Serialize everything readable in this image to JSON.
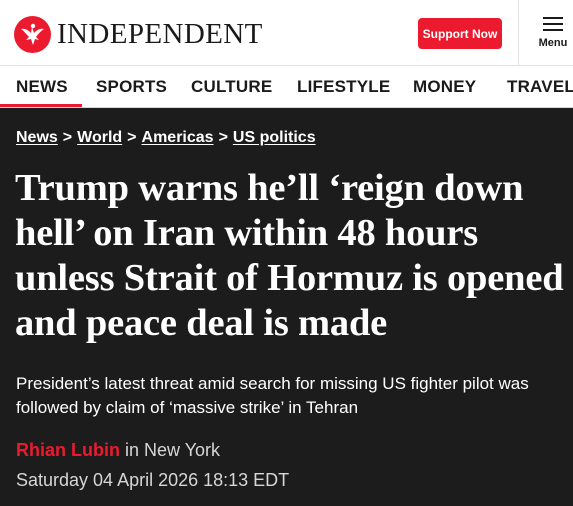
{
  "header": {
    "logo_text": "INDEPENDENT",
    "support_label": "Support Now",
    "menu_label": "Menu",
    "brand_color": "#ec1a2e"
  },
  "nav": {
    "items": [
      {
        "label": "NEWS",
        "active": true
      },
      {
        "label": "SPORTS"
      },
      {
        "label": "CULTURE"
      },
      {
        "label": "LIFESTYLE"
      },
      {
        "label": "MONEY"
      },
      {
        "label": "TRAVEL"
      }
    ]
  },
  "breadcrumb": {
    "items": [
      "News",
      "World",
      "Americas",
      "US politics"
    ],
    "separator": ">"
  },
  "article": {
    "headline": "Trump warns he’ll ‘reign down hell’ on Iran within 48 hours unless Strait of Hormuz is opened and peace deal is made",
    "standfirst": "President’s latest threat amid search for missing US fighter pilot was followed by claim of ‘massive strike’ in Tehran",
    "author": "Rhian Lubin",
    "location": "in New York",
    "date": "Saturday 04 April 2026 18:13 EDT"
  },
  "icons": {
    "logo": "eagle-logo-icon",
    "menu": "hamburger-menu-icon"
  }
}
